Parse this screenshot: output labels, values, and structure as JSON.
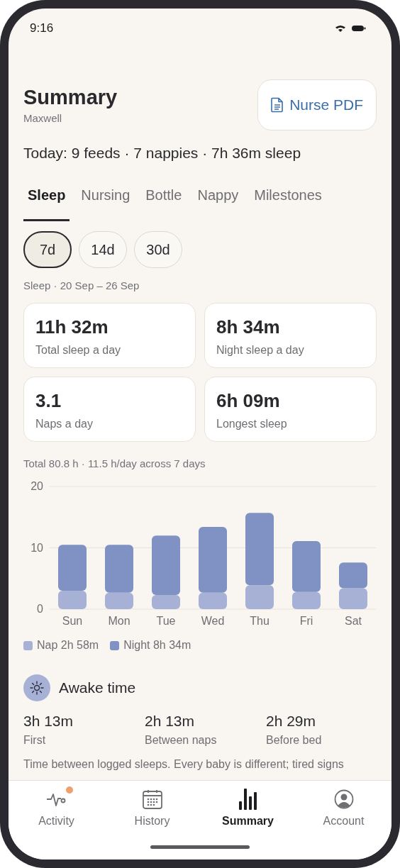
{
  "status_bar": {
    "time": "9:16"
  },
  "header": {
    "title": "Summary",
    "subtitle": "Maxwell",
    "button": "Nurse PDF"
  },
  "today": "Today: 9 feeds · 7 nappies · 7h 36m sleep",
  "tabs": [
    {
      "label": "Sleep",
      "selected": true
    },
    {
      "label": "Nursing",
      "selected": false
    },
    {
      "label": "Bottle",
      "selected": false
    },
    {
      "label": "Nappy",
      "selected": false
    },
    {
      "label": "Milestones",
      "selected": false
    }
  ],
  "ranges": [
    {
      "label": "7d",
      "selected": true
    },
    {
      "label": "14d",
      "selected": false
    },
    {
      "label": "30d",
      "selected": false
    }
  ],
  "range_caption": "Sleep · 20 Sep – 26 Sep",
  "stats": [
    {
      "value": "11h 32m",
      "label": "Total sleep a day"
    },
    {
      "value": "8h 34m",
      "label": "Night sleep a day"
    },
    {
      "value": "3.1",
      "label": "Naps a day"
    },
    {
      "value": "6h 09m",
      "label": "Longest sleep"
    }
  ],
  "chart_caption": "Total 80.8 h · 11.5 h/day across 7 days",
  "chart_data": {
    "type": "bar",
    "stacked": true,
    "categories": [
      "Sun",
      "Mon",
      "Tue",
      "Wed",
      "Thu",
      "Fri",
      "Sat"
    ],
    "ylim": [
      0,
      20
    ],
    "yticks": [
      0,
      10,
      20
    ],
    "series": [
      {
        "name": "Nap",
        "color": "#a7b1d6",
        "values": [
          3.0,
          2.7,
          2.3,
          2.7,
          3.9,
          2.8,
          3.4
        ]
      },
      {
        "name": "Night",
        "color": "#7f92c3",
        "values": [
          7.5,
          7.8,
          9.7,
          10.7,
          11.8,
          8.3,
          4.2
        ]
      }
    ]
  },
  "legend": [
    {
      "value": "2h 58m"
    },
    {
      "value": "8h 34m"
    }
  ],
  "awake": {
    "title": "Awake time",
    "items": [
      {
        "value": "3h 13m",
        "label": "First"
      },
      {
        "value": "2h 13m",
        "label": "Between naps"
      },
      {
        "value": "2h 29m",
        "label": "Before bed"
      }
    ],
    "note": "Time between logged sleeps. Every baby is different; tired signs"
  },
  "nav": [
    {
      "label": "Activity",
      "selected": false,
      "badge": true
    },
    {
      "label": "History",
      "selected": false,
      "badge": false
    },
    {
      "label": "Summary",
      "selected": true,
      "badge": false
    },
    {
      "label": "Account",
      "selected": false,
      "badge": false
    }
  ]
}
